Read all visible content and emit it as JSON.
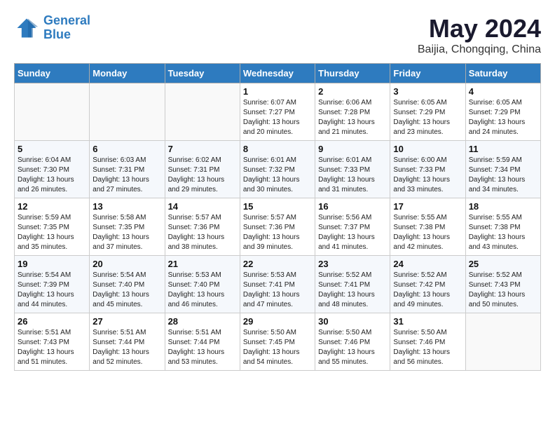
{
  "header": {
    "logo_line1": "General",
    "logo_line2": "Blue",
    "month": "May 2024",
    "location": "Baijia, Chongqing, China"
  },
  "days_of_week": [
    "Sunday",
    "Monday",
    "Tuesday",
    "Wednesday",
    "Thursday",
    "Friday",
    "Saturday"
  ],
  "weeks": [
    [
      {
        "day": "",
        "info": ""
      },
      {
        "day": "",
        "info": ""
      },
      {
        "day": "",
        "info": ""
      },
      {
        "day": "1",
        "info": "Sunrise: 6:07 AM\nSunset: 7:27 PM\nDaylight: 13 hours\nand 20 minutes."
      },
      {
        "day": "2",
        "info": "Sunrise: 6:06 AM\nSunset: 7:28 PM\nDaylight: 13 hours\nand 21 minutes."
      },
      {
        "day": "3",
        "info": "Sunrise: 6:05 AM\nSunset: 7:29 PM\nDaylight: 13 hours\nand 23 minutes."
      },
      {
        "day": "4",
        "info": "Sunrise: 6:05 AM\nSunset: 7:29 PM\nDaylight: 13 hours\nand 24 minutes."
      }
    ],
    [
      {
        "day": "5",
        "info": "Sunrise: 6:04 AM\nSunset: 7:30 PM\nDaylight: 13 hours\nand 26 minutes."
      },
      {
        "day": "6",
        "info": "Sunrise: 6:03 AM\nSunset: 7:31 PM\nDaylight: 13 hours\nand 27 minutes."
      },
      {
        "day": "7",
        "info": "Sunrise: 6:02 AM\nSunset: 7:31 PM\nDaylight: 13 hours\nand 29 minutes."
      },
      {
        "day": "8",
        "info": "Sunrise: 6:01 AM\nSunset: 7:32 PM\nDaylight: 13 hours\nand 30 minutes."
      },
      {
        "day": "9",
        "info": "Sunrise: 6:01 AM\nSunset: 7:33 PM\nDaylight: 13 hours\nand 31 minutes."
      },
      {
        "day": "10",
        "info": "Sunrise: 6:00 AM\nSunset: 7:33 PM\nDaylight: 13 hours\nand 33 minutes."
      },
      {
        "day": "11",
        "info": "Sunrise: 5:59 AM\nSunset: 7:34 PM\nDaylight: 13 hours\nand 34 minutes."
      }
    ],
    [
      {
        "day": "12",
        "info": "Sunrise: 5:59 AM\nSunset: 7:35 PM\nDaylight: 13 hours\nand 35 minutes."
      },
      {
        "day": "13",
        "info": "Sunrise: 5:58 AM\nSunset: 7:35 PM\nDaylight: 13 hours\nand 37 minutes."
      },
      {
        "day": "14",
        "info": "Sunrise: 5:57 AM\nSunset: 7:36 PM\nDaylight: 13 hours\nand 38 minutes."
      },
      {
        "day": "15",
        "info": "Sunrise: 5:57 AM\nSunset: 7:36 PM\nDaylight: 13 hours\nand 39 minutes."
      },
      {
        "day": "16",
        "info": "Sunrise: 5:56 AM\nSunset: 7:37 PM\nDaylight: 13 hours\nand 41 minutes."
      },
      {
        "day": "17",
        "info": "Sunrise: 5:55 AM\nSunset: 7:38 PM\nDaylight: 13 hours\nand 42 minutes."
      },
      {
        "day": "18",
        "info": "Sunrise: 5:55 AM\nSunset: 7:38 PM\nDaylight: 13 hours\nand 43 minutes."
      }
    ],
    [
      {
        "day": "19",
        "info": "Sunrise: 5:54 AM\nSunset: 7:39 PM\nDaylight: 13 hours\nand 44 minutes."
      },
      {
        "day": "20",
        "info": "Sunrise: 5:54 AM\nSunset: 7:40 PM\nDaylight: 13 hours\nand 45 minutes."
      },
      {
        "day": "21",
        "info": "Sunrise: 5:53 AM\nSunset: 7:40 PM\nDaylight: 13 hours\nand 46 minutes."
      },
      {
        "day": "22",
        "info": "Sunrise: 5:53 AM\nSunset: 7:41 PM\nDaylight: 13 hours\nand 47 minutes."
      },
      {
        "day": "23",
        "info": "Sunrise: 5:52 AM\nSunset: 7:41 PM\nDaylight: 13 hours\nand 48 minutes."
      },
      {
        "day": "24",
        "info": "Sunrise: 5:52 AM\nSunset: 7:42 PM\nDaylight: 13 hours\nand 49 minutes."
      },
      {
        "day": "25",
        "info": "Sunrise: 5:52 AM\nSunset: 7:43 PM\nDaylight: 13 hours\nand 50 minutes."
      }
    ],
    [
      {
        "day": "26",
        "info": "Sunrise: 5:51 AM\nSunset: 7:43 PM\nDaylight: 13 hours\nand 51 minutes."
      },
      {
        "day": "27",
        "info": "Sunrise: 5:51 AM\nSunset: 7:44 PM\nDaylight: 13 hours\nand 52 minutes."
      },
      {
        "day": "28",
        "info": "Sunrise: 5:51 AM\nSunset: 7:44 PM\nDaylight: 13 hours\nand 53 minutes."
      },
      {
        "day": "29",
        "info": "Sunrise: 5:50 AM\nSunset: 7:45 PM\nDaylight: 13 hours\nand 54 minutes."
      },
      {
        "day": "30",
        "info": "Sunrise: 5:50 AM\nSunset: 7:46 PM\nDaylight: 13 hours\nand 55 minutes."
      },
      {
        "day": "31",
        "info": "Sunrise: 5:50 AM\nSunset: 7:46 PM\nDaylight: 13 hours\nand 56 minutes."
      },
      {
        "day": "",
        "info": ""
      }
    ]
  ]
}
